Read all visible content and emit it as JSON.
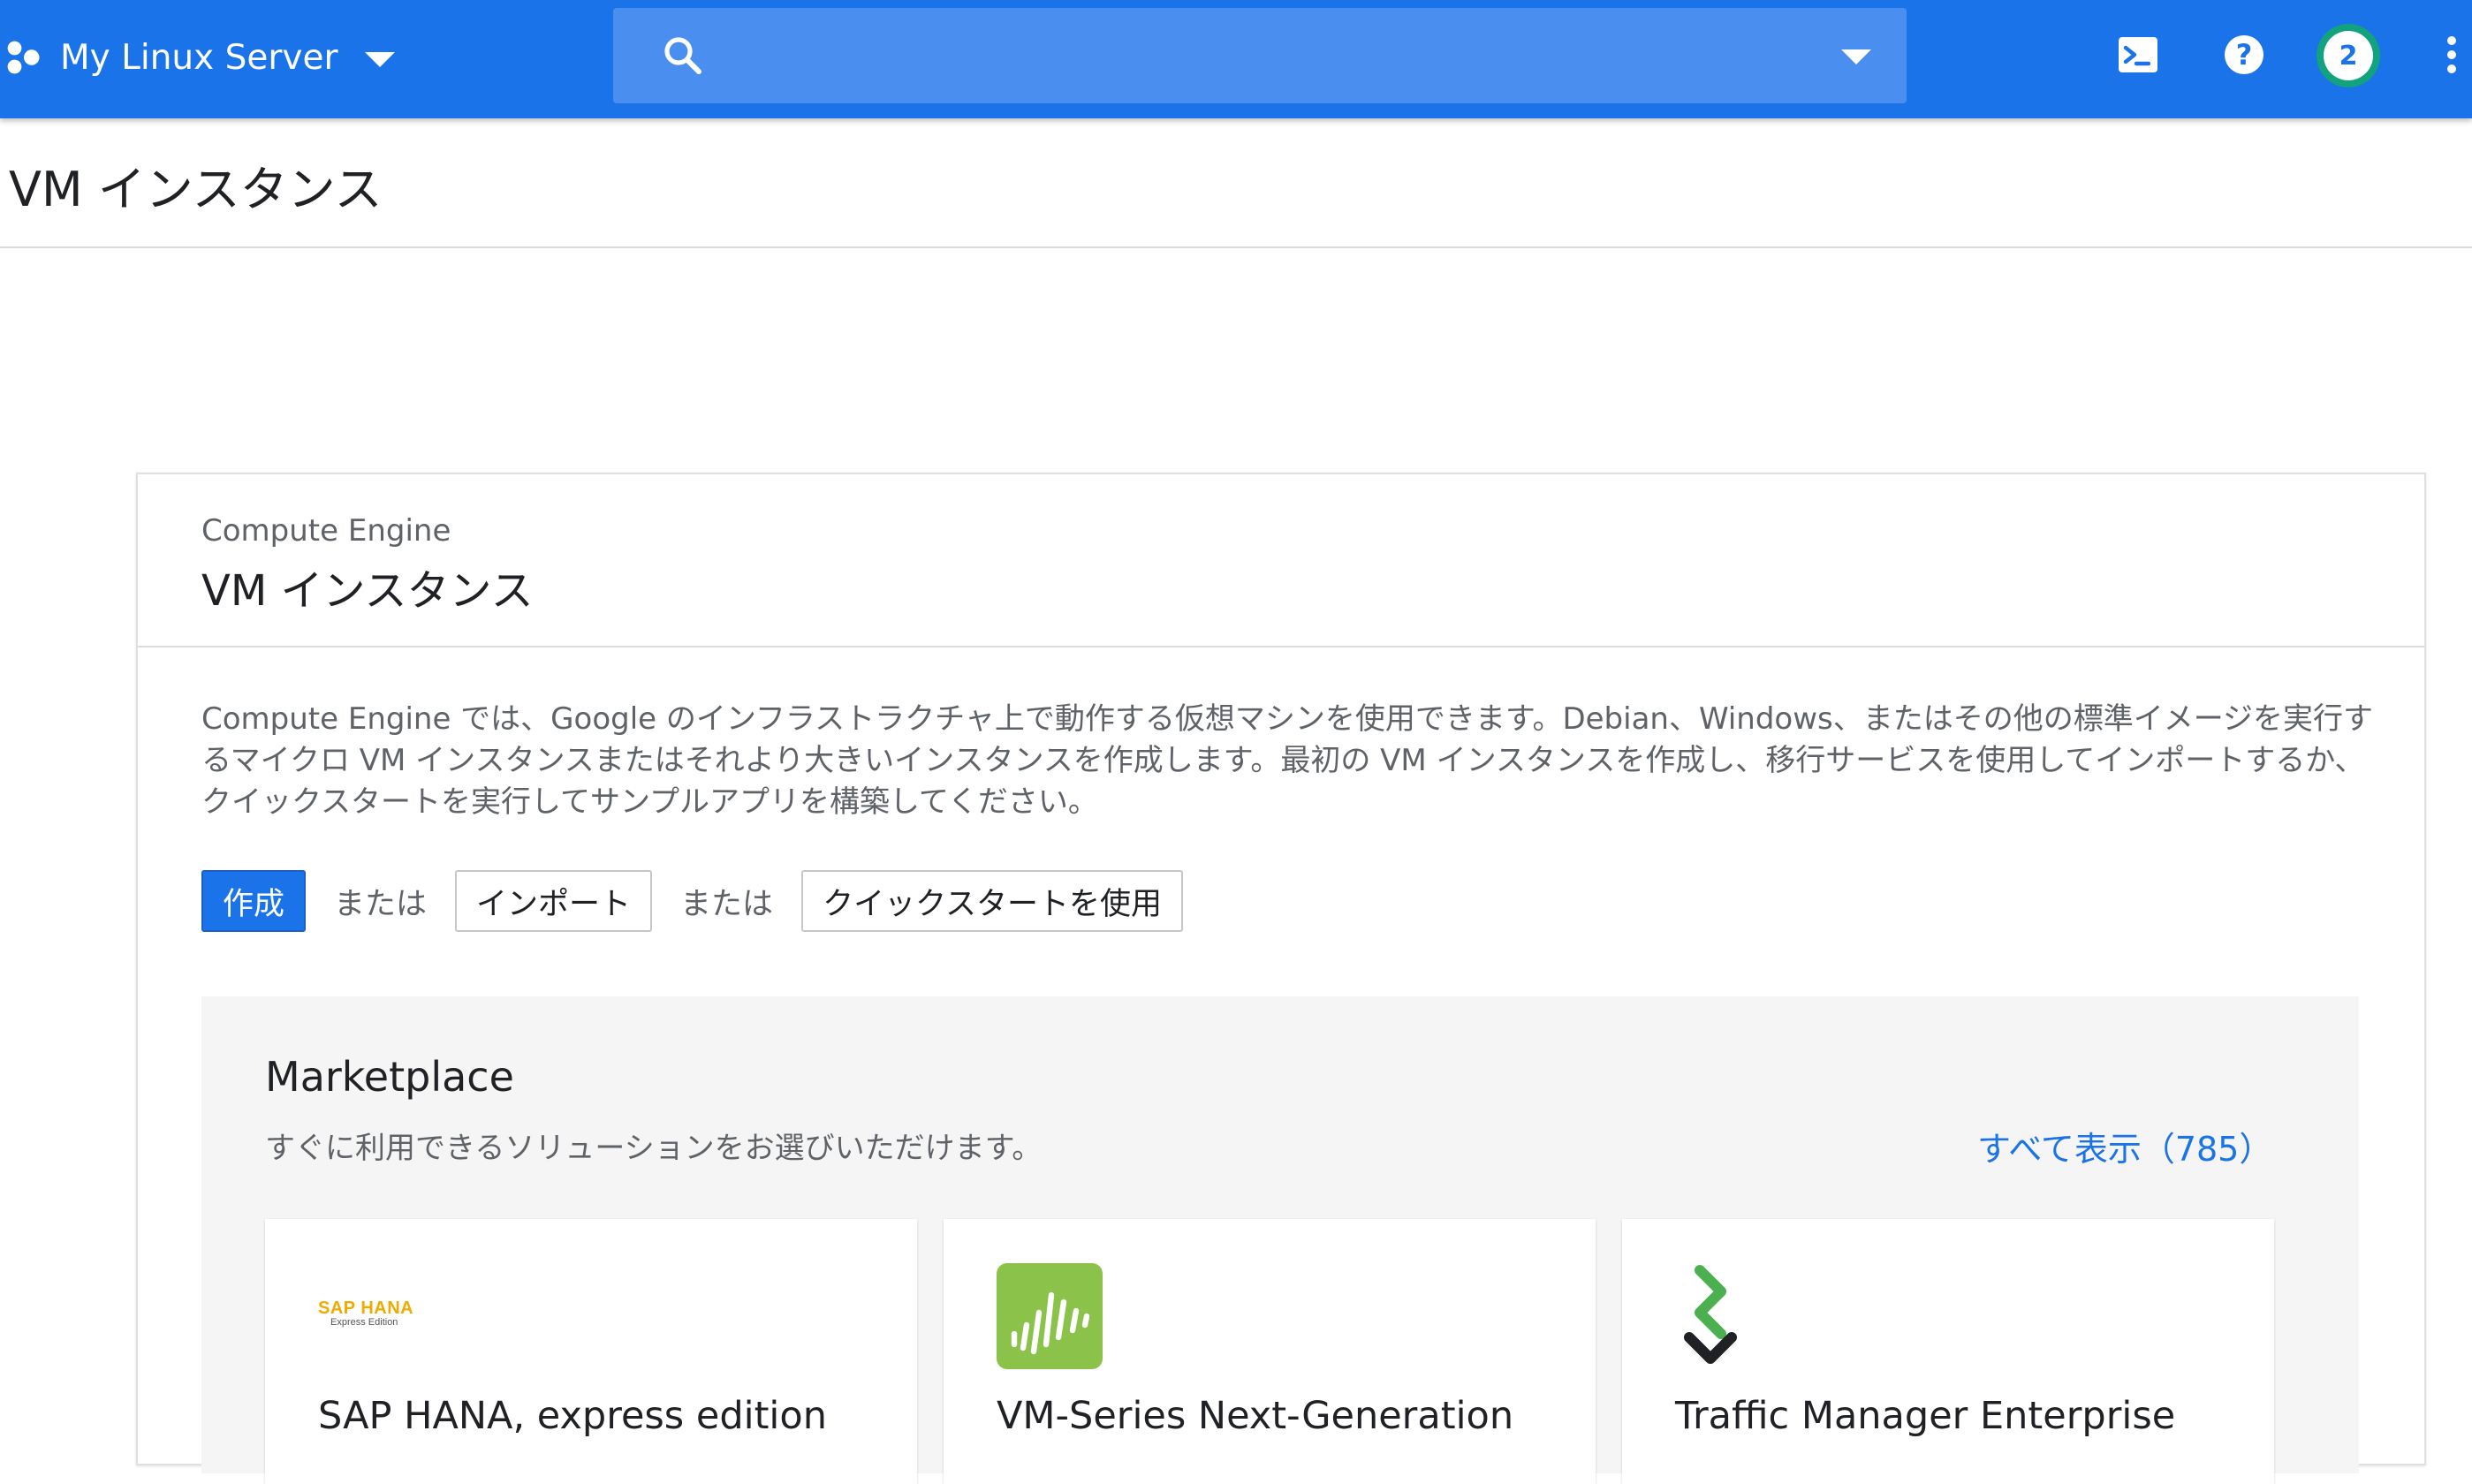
{
  "topbar": {
    "project_name": "My Linux Server",
    "search_placeholder": "",
    "notifications_count": "2",
    "icons": [
      "project-icon",
      "search-icon",
      "cloud-shell-icon",
      "help-icon",
      "notifications-badge",
      "more-vert-icon"
    ]
  },
  "page": {
    "title": "VM インスタンス"
  },
  "card": {
    "subtitle": "Compute Engine",
    "title": "VM インスタンス",
    "description": "Compute Engine では、Google のインフラストラクチャ上で動作する仮想マシンを使用できます。Debian、Windows、またはその他の標準イメージを実行するマイクロ VM インスタンスまたはそれより大きいインスタンスを作成します。最初の VM インスタンスを作成し、移行サービスを使用してインポートするか、クイックスタートを実行してサンプルアプリを構築してください。",
    "actions": {
      "create": "作成",
      "or1": "または",
      "import": "インポート",
      "or2": "または",
      "quickstart": "クイックスタートを使用"
    }
  },
  "marketplace": {
    "title": "Marketplace",
    "subtitle": "すぐに利用できるソリューションをお選びいただけます。",
    "view_all": "すべて表示（785）",
    "items": [
      {
        "name": "SAP HANA, express edition",
        "logo_text": "SAP HANA",
        "logo_subtext": "Express Edition",
        "icon": "sap-hana-logo"
      },
      {
        "name": "VM-Series Next-Generation",
        "icon": "vm-series-logo"
      },
      {
        "name": "Traffic Manager Enterprise",
        "icon": "traffic-manager-logo"
      }
    ]
  },
  "colors": {
    "brand_blue": "#1a73e8",
    "notif_ring": "#12a37e",
    "vm_series_green": "#8bc34a",
    "sap_gold": "#f0ab00"
  }
}
